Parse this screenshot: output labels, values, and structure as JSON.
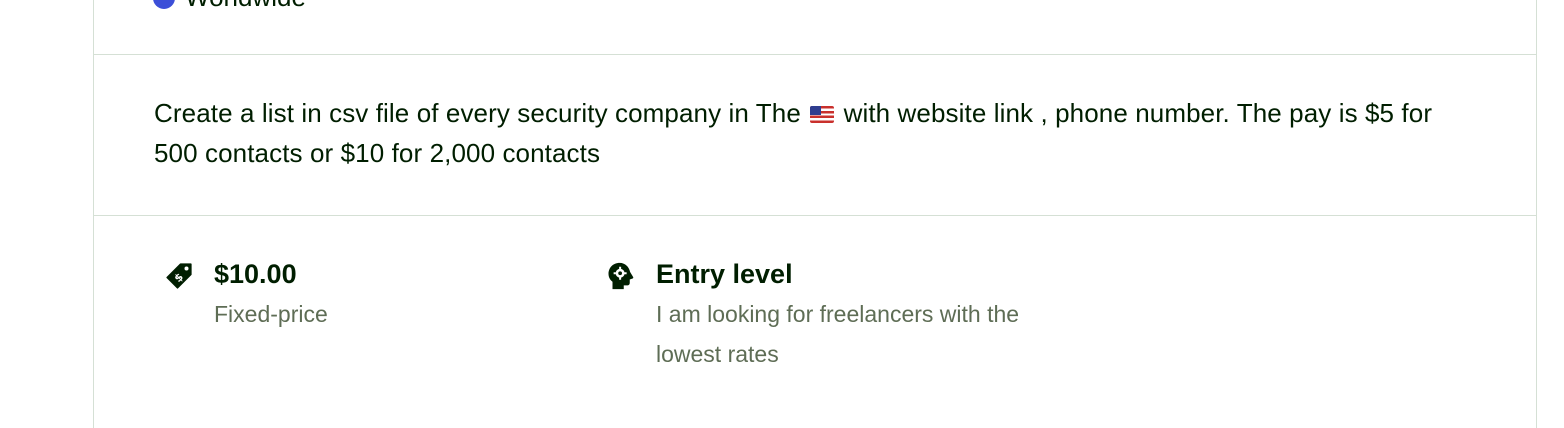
{
  "job": {
    "location": "Worldwide",
    "description_before_flag": "Create a list in csv file of every  security company in The ",
    "description_after_flag": " with website link , phone number. The pay is $5 for 500 contacts or $10 for 2,000 contacts",
    "budget": {
      "amount": "$10.00",
      "type": "Fixed-price",
      "icon": "price-tag-icon"
    },
    "experience": {
      "level": "Entry level",
      "detail": "I am looking for freelancers with the lowest rates",
      "icon": "head-gear-icon"
    }
  },
  "colors": {
    "text": "#001e00",
    "muted": "#5e6d55",
    "border": "#d5e0d5"
  }
}
